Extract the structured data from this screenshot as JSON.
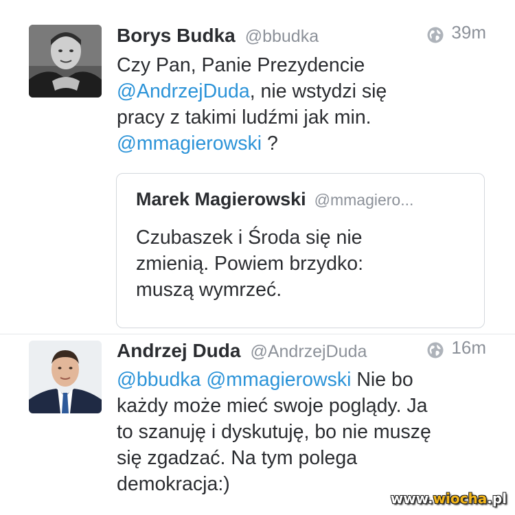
{
  "tweets": [
    {
      "author_name": "Borys Budka",
      "handle": "@bbudka",
      "time": "39m",
      "visibility_icon": "globe-icon",
      "avatar_icon": "avatar-photo-bw",
      "text_lines": [
        [
          {
            "t": "Czy Pan, Panie Prezydencie",
            "mention": false
          }
        ],
        [
          {
            "t": "@AndrzejDuda",
            "mention": true
          },
          {
            "t": ", nie wstydzi się",
            "mention": false
          }
        ],
        [
          {
            "t": "pracy z takimi ludźmi jak min.",
            "mention": false
          }
        ],
        [
          {
            "t": "@mmagierowski",
            "mention": true
          },
          {
            "t": " ?",
            "mention": false
          }
        ]
      ]
    },
    {
      "author_name": "Andrzej Duda",
      "handle": "@AndrzejDuda",
      "time": "16m",
      "visibility_icon": "globe-icon",
      "avatar_icon": "avatar-photo-color",
      "text_lines": [
        [
          {
            "t": "@bbudka",
            "mention": true
          },
          {
            "t": " ",
            "mention": false
          },
          {
            "t": "@mmagierowski",
            "mention": true
          },
          {
            "t": " Nie bo",
            "mention": false
          }
        ],
        [
          {
            "t": "każdy może mieć swoje poglądy. Ja",
            "mention": false
          }
        ],
        [
          {
            "t": "to szanuję i dyskutuję, bo nie muszę",
            "mention": false
          }
        ],
        [
          {
            "t": "się zgadzać. Na tym polega",
            "mention": false
          }
        ],
        [
          {
            "t": "demokracja:)",
            "mention": false
          }
        ]
      ]
    }
  ],
  "quote": {
    "author_name": "Marek Magierowski",
    "handle": "@mmagiero...",
    "text_lines": [
      "Czubaszek i Środa się nie",
      "zmienią. Powiem brzydko:",
      "muszą wymrzeć."
    ]
  },
  "watermark": {
    "prefix": "www.",
    "brand": "wiocha",
    "suffix": ".pl"
  },
  "colors": {
    "mention": "#2b93d8",
    "text": "#2a2c30",
    "muted": "#8c9199",
    "card_border": "#d3d7dc",
    "watermark_accent": "#f5b719"
  }
}
